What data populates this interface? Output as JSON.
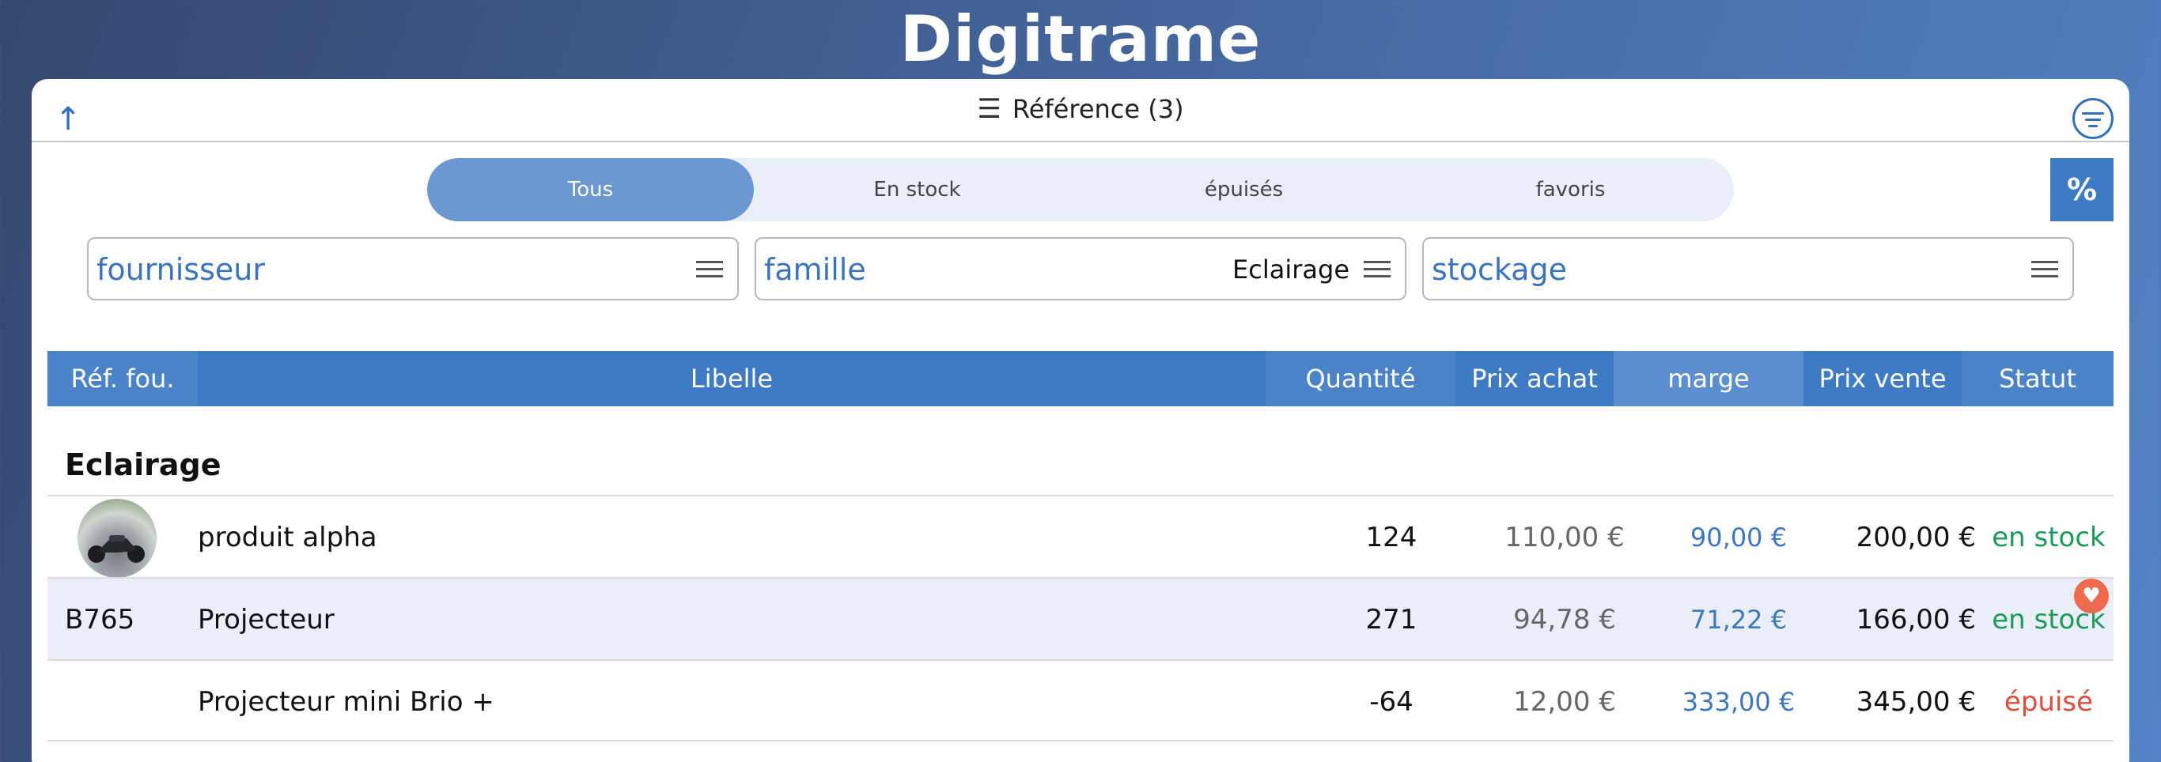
{
  "app": {
    "logo_text": "Digitrame"
  },
  "header": {
    "title": "Référence (3)",
    "up_icon": "arrow-up-icon",
    "list_icon": "numbered-list-icon",
    "filter_icon": "filter-circle-icon"
  },
  "tabs": [
    {
      "label": "Tous",
      "active": true
    },
    {
      "label": "En stock",
      "active": false
    },
    {
      "label": "épuisés",
      "active": false
    },
    {
      "label": "favoris",
      "active": false
    }
  ],
  "percent_button": {
    "label": "%"
  },
  "filters": {
    "fournisseur": {
      "placeholder": "fournisseur",
      "value": ""
    },
    "famille": {
      "placeholder": "famille",
      "value": "Eclairage"
    },
    "stockage": {
      "placeholder": "stockage",
      "value": ""
    }
  },
  "table": {
    "headers": [
      "Réf. fou.",
      "Libelle",
      "Quantité",
      "Prix achat",
      "marge",
      "Prix vente",
      "Statut"
    ],
    "group": "Eclairage",
    "rows": [
      {
        "ref": "",
        "libelle": "produit alpha",
        "quantite": "124",
        "prix_achat": "110,00 €",
        "marge": "90,00 €",
        "prix_vente": "200,00 €",
        "statut": "en stock",
        "status_color": "#1c9a58",
        "has_thumbnail": true,
        "favorite": false
      },
      {
        "ref": "B765",
        "libelle": "Projecteur",
        "quantite": "271",
        "prix_achat": "94,78 €",
        "marge": "71,22 €",
        "prix_vente": "166,00 €",
        "statut": "en stock",
        "status_color": "#1c9a58",
        "has_thumbnail": false,
        "favorite": true
      },
      {
        "ref": "",
        "libelle": "Projecteur mini Brio +",
        "quantite": "-64",
        "prix_achat": "12,00 €",
        "marge": "333,00 €",
        "prix_vente": "345,00 €",
        "statut": "épuisé",
        "status_color": "#e24a3a",
        "has_thumbnail": false,
        "favorite": false
      }
    ]
  },
  "colors": {
    "accent": "#3f7ac4",
    "header_blue": "#3f7ac4",
    "in_stock": "#1c9a58",
    "out_of_stock": "#e24a3a"
  }
}
